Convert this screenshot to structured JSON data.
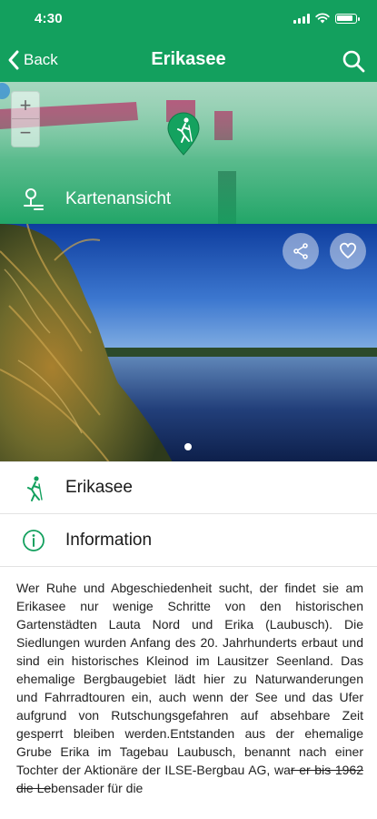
{
  "status_bar": {
    "time": "4:30"
  },
  "header": {
    "back_label": "Back",
    "title": "Erikasee",
    "search_icon": "search-icon",
    "back_icon": "chevron-left-icon"
  },
  "map": {
    "zoom_in": "+",
    "zoom_out": "−",
    "pin_icon": "hiker-pin-icon",
    "link_label": "Kartenansicht",
    "link_icon": "map-location-icon"
  },
  "photo": {
    "share_icon": "share-icon",
    "favorite_icon": "heart-icon",
    "page_indicator": {
      "pages": 1,
      "current": 1
    }
  },
  "rows": [
    {
      "label": "Erikasee",
      "icon": "hiker-icon"
    },
    {
      "label": "Information",
      "icon": "info-circle-icon"
    }
  ],
  "description": {
    "text_before": "Wer Ruhe und Abgeschiedenheit sucht, der findet sie am Erikasee nur wenige Schritte von den historischen Gartenstädten Lauta Nord und Erika (Laubusch). Die Siedlungen wurden Anfang des 20. Jahrhunderts erbaut und sind ein historisches Kleinod im Lausitzer Seenland. Das ehemalige Bergbaugebiet lädt hier zu Naturwanderungen und Fahrradtouren ein, auch wenn der See und das Ufer aufgrund von Rutschungsgefahren auf absehbare Zeit gesperrt bleiben werden.Entstanden aus der ehemalige Grube Erika im Tagebau Laubusch, benannt nach einer Tochter der Aktionäre der ILSE-Bergbau AG, wa",
    "text_struck": "r er bis 1962 die Le",
    "text_after": "bensader für die"
  },
  "colors": {
    "brand_green": "#13a05e",
    "map_green": "#8ec8ab",
    "route_magenta": "#c8336f"
  }
}
